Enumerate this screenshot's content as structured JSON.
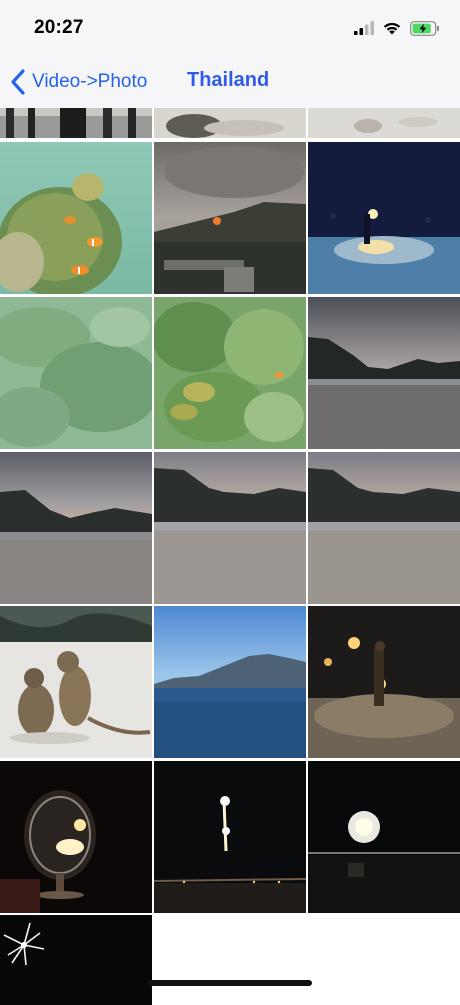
{
  "status": {
    "time": "20:27",
    "battery_level": 0.85,
    "battery_color": "#4cd964"
  },
  "nav": {
    "back_label": "Video->Photo",
    "title": "Thailand",
    "accent": "#2563eb"
  },
  "photos": [
    {
      "subject": "beach-trees-edge"
    },
    {
      "subject": "beach-sand-rocks"
    },
    {
      "subject": "beach-sand-shells"
    },
    {
      "subject": "clownfish-coral"
    },
    {
      "subject": "sunset-hillside-village"
    },
    {
      "subject": "fire-dancer-beach-night"
    },
    {
      "subject": "underwater-coral-green"
    },
    {
      "subject": "anemone-clownfish"
    },
    {
      "subject": "beach-dusk-mountains"
    },
    {
      "subject": "beach-dusk-wide"
    },
    {
      "subject": "beach-dusk-hills"
    },
    {
      "subject": "beach-dusk-hills-2"
    },
    {
      "subject": "monkeys-on-sand"
    },
    {
      "subject": "sea-mountains-blue-sky"
    },
    {
      "subject": "fire-dancer-night"
    },
    {
      "subject": "candle-glass-night"
    },
    {
      "subject": "fireworks-single"
    },
    {
      "subject": "fireworks-burst"
    },
    {
      "subject": "fireworks-sparkler"
    }
  ]
}
